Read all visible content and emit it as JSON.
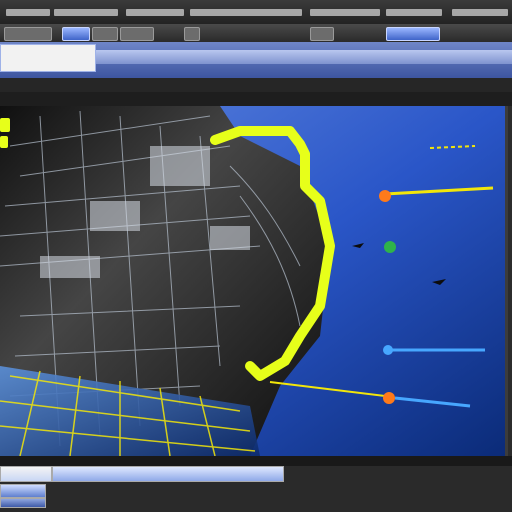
{
  "window": {
    "title": "",
    "menus": [
      "",
      "",
      "",
      "",
      "",
      "",
      ""
    ]
  },
  "toolbar": {
    "buttons": [
      "",
      "",
      "",
      "",
      "",
      "",
      ""
    ]
  },
  "ribbon": {
    "field_text": ""
  },
  "panel": {
    "header_label": ""
  },
  "viewport": {
    "annotations": [
      {
        "color": "#f2e60a"
      },
      {
        "color": "#ff7a1a"
      },
      {
        "color": "#2fb34a"
      },
      {
        "color": "#47a7ff"
      }
    ]
  },
  "colors": {
    "highlight": "#e7ff1a",
    "accent_blue": "#2b6cff",
    "panel_dark": "#2c2c2c"
  }
}
